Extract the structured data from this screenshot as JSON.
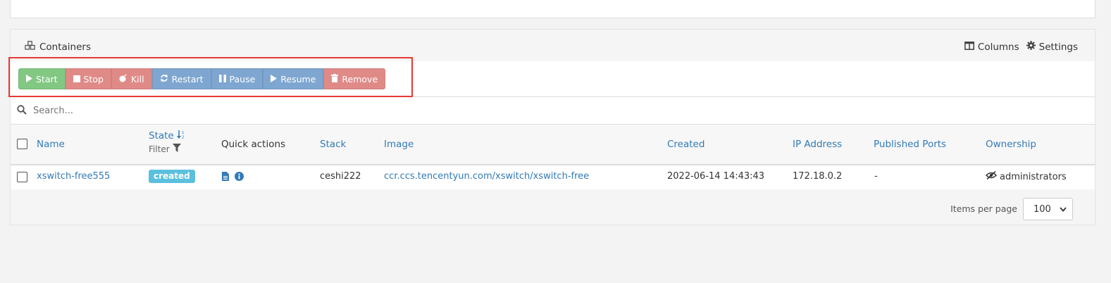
{
  "panel": {
    "title": "Containers",
    "columns_label": "Columns",
    "settings_label": "Settings"
  },
  "actions": {
    "start": "Start",
    "stop": "Stop",
    "kill": "Kill",
    "restart": "Restart",
    "pause": "Pause",
    "resume": "Resume",
    "remove": "Remove"
  },
  "search": {
    "placeholder": "Search..."
  },
  "table": {
    "headers": {
      "name": "Name",
      "state": "State",
      "filter": "Filter",
      "quick_actions": "Quick actions",
      "stack": "Stack",
      "image": "Image",
      "created": "Created",
      "ip": "IP Address",
      "ports": "Published Ports",
      "ownership": "Ownership"
    },
    "rows": [
      {
        "name": "xswitch-free555",
        "state": "created",
        "stack": "ceshi222",
        "image": "ccr.ccs.tencentyun.com/xswitch/xswitch-free",
        "created": "2022-06-14 14:43:43",
        "ip": "172.18.0.2",
        "ports": "-",
        "ownership": "administrators"
      }
    ]
  },
  "pagination": {
    "items_per_page_label": "Items per page",
    "items_per_page_value": "100"
  },
  "colors": {
    "start": "#82c882",
    "danger": "#e08a88",
    "primary": "#7ea6d0",
    "badge": "#5bc0de",
    "link": "#337ab7",
    "highlight": "#e53935"
  }
}
